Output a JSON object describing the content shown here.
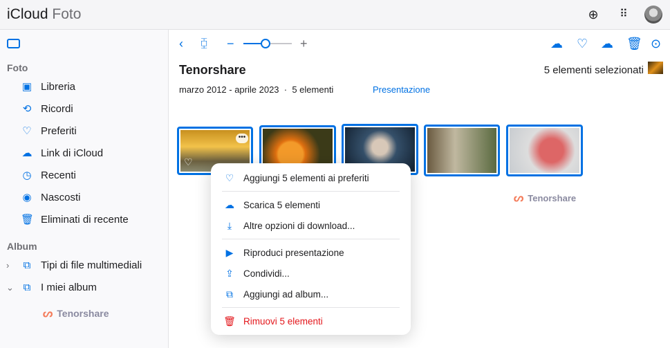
{
  "header": {
    "brand": "iCloud",
    "app": "Foto",
    "icons": [
      "plus-circle-icon",
      "grid-icon",
      "avatar"
    ]
  },
  "sidebar": {
    "section_foto": "Foto",
    "items": [
      {
        "label": "Libreria",
        "icon": "photos-icon"
      },
      {
        "label": "Ricordi",
        "icon": "memories-icon"
      },
      {
        "label": "Preferiti",
        "icon": "heart-icon"
      },
      {
        "label": "Link di iCloud",
        "icon": "cloud-link-icon"
      },
      {
        "label": "Recenti",
        "icon": "clock-icon"
      },
      {
        "label": "Nascosti",
        "icon": "eye-slash-icon"
      },
      {
        "label": "Eliminati di recente",
        "icon": "trash-icon"
      }
    ],
    "section_album": "Album",
    "albums": [
      {
        "label": "Tipi di file multimediali"
      },
      {
        "label": "I miei album"
      }
    ],
    "watermark": "Tenorshare"
  },
  "toolbar": {
    "zoom_level": 0.45
  },
  "album": {
    "title": "Tenorshare",
    "date_range": "marzo 2012 - aprile 2023",
    "count": "5 elementi",
    "separator": "·",
    "slideshow": "Presentazione",
    "selected": "5 elementi selezionati"
  },
  "menu": {
    "items": [
      "Aggiungi 5 elementi ai preferiti",
      "Scarica 5 elementi",
      "Altre opzioni di download...",
      "Riproduci presentazione",
      "Condividi...",
      "Aggiungi ad album...",
      "Rimuovi 5 elementi"
    ]
  },
  "watermark": "Tenorshare",
  "colors": {
    "accent": "#0071e3",
    "danger": "#e3161b"
  }
}
